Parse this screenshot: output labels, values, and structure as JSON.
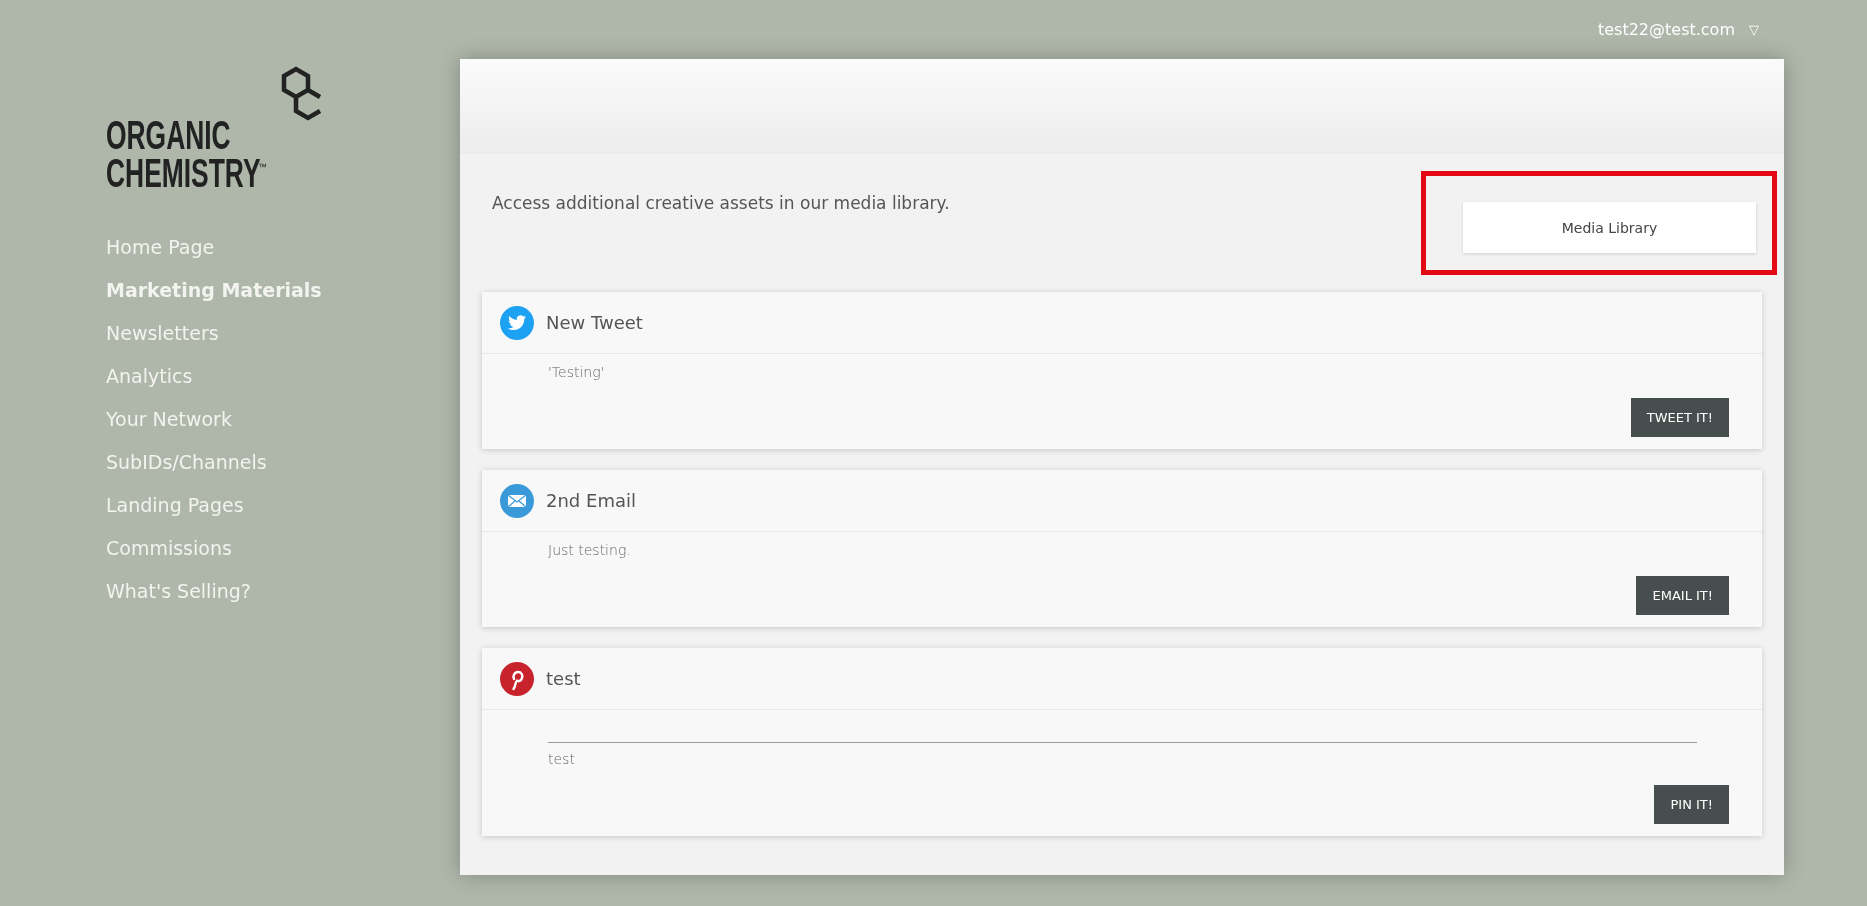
{
  "user_menu": {
    "email": "test22@test.com",
    "caret": "▽"
  },
  "logo": {
    "line_1": "ORGANIC",
    "line_2": "CHEMISTRY",
    "mark": "™"
  },
  "sidebar": {
    "items": [
      {
        "label": "Home Page",
        "selected": false
      },
      {
        "label": "Marketing Materials",
        "selected": true
      },
      {
        "label": "Newsletters",
        "selected": false
      },
      {
        "label": "Analytics",
        "selected": false
      },
      {
        "label": "Your Network",
        "selected": false
      },
      {
        "label": "SubIDs/Channels",
        "selected": false
      },
      {
        "label": "Landing Pages",
        "selected": false
      },
      {
        "label": "Commissions",
        "selected": false
      },
      {
        "label": "What's Selling?",
        "selected": false
      }
    ]
  },
  "media": {
    "text": "Access additional creative assets in our media library.",
    "button": "Media Library",
    "highlighted": true
  },
  "posts": [
    {
      "kind": "twitter",
      "title": "New Tweet",
      "body": "'Testing'",
      "button": "TWEET IT!"
    },
    {
      "kind": "email",
      "title": "2nd Email",
      "body": "Just testing.",
      "button": "EMAIL IT!"
    },
    {
      "kind": "pinterest",
      "title": "test",
      "body": "test",
      "button": "PIN IT!"
    }
  ]
}
